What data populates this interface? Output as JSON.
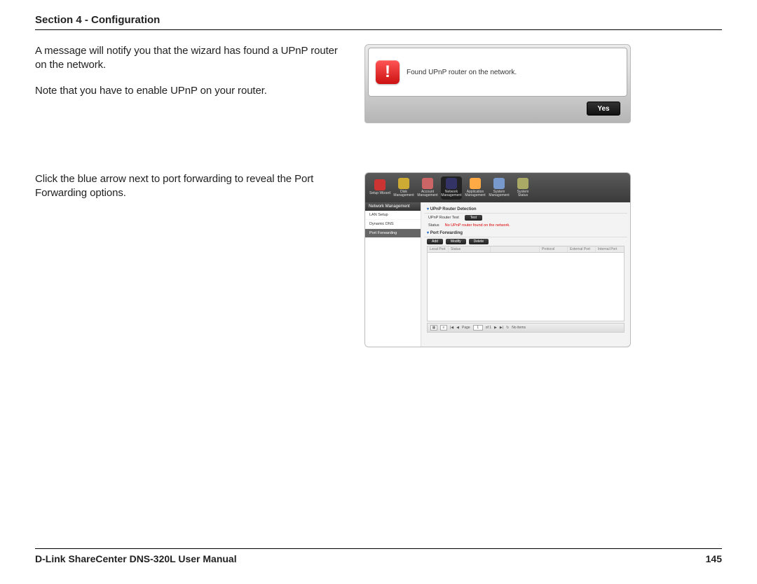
{
  "header": {
    "title": "Section 4 - Configuration"
  },
  "footer": {
    "manual": "D-Link ShareCenter DNS-320L User Manual",
    "page": "145"
  },
  "blocks": [
    {
      "paragraphs": [
        "A message will notify you that the wizard has found a UPnP router on the network.",
        "Note that you have to enable UPnP on your router."
      ],
      "dialog": {
        "icon": "!",
        "message": "Found UPnP router on the network.",
        "button": "Yes"
      }
    },
    {
      "paragraphs": [
        "Click the blue arrow next to port forwarding to reveal the Port Forwarding options."
      ],
      "app": {
        "nav": [
          {
            "label": "Setup Wizard",
            "color": "#c33"
          },
          {
            "label": "Disk Management",
            "color": "#ca3"
          },
          {
            "label": "Account Management",
            "color": "#c66"
          },
          {
            "label": "Network Management",
            "color": "#336",
            "selected": true
          },
          {
            "label": "Application Management",
            "color": "#fa4"
          },
          {
            "label": "System Management",
            "color": "#79c"
          },
          {
            "label": "System Status",
            "color": "#aa6"
          }
        ],
        "sidebar": {
          "title": "Network Management",
          "items": [
            {
              "label": "LAN Setup"
            },
            {
              "label": "Dynamic DNS"
            },
            {
              "label": "Port Forwarding",
              "active": true
            }
          ]
        },
        "panels": {
          "detection": {
            "title": "UPnP Router Detection",
            "rows": [
              {
                "label": "UPnP Router Test",
                "button": "Test"
              },
              {
                "label": "Status",
                "value": "No UPnP router found on the network.",
                "red": true
              }
            ]
          },
          "portForwarding": {
            "title": "Port Forwarding",
            "toolbar": [
              "Add",
              "Modify",
              "Delete"
            ],
            "columns": [
              "Local Port",
              "Status",
              "",
              "Protocol",
              "External Port",
              "Internal Port"
            ],
            "pager": {
              "page": "1",
              "of": "of 1",
              "info": "No items"
            }
          }
        }
      }
    }
  ]
}
